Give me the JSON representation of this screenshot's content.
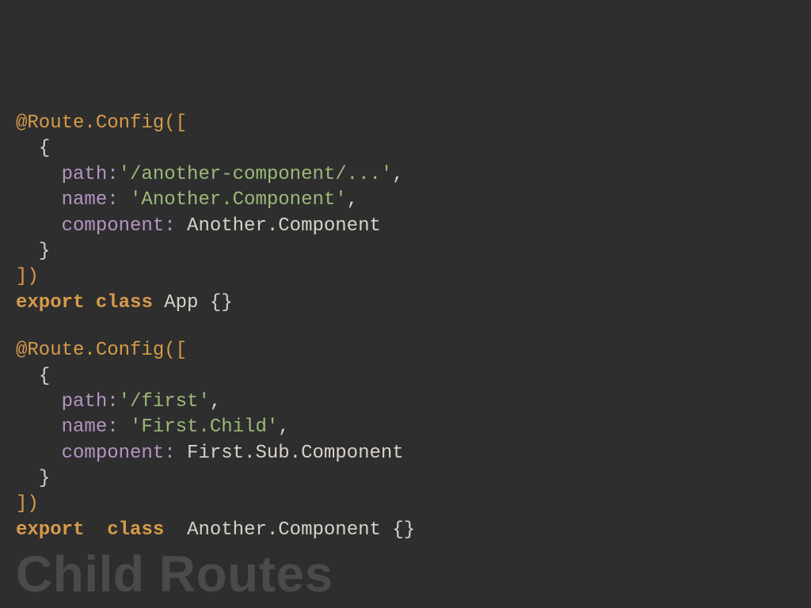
{
  "block1": {
    "decor": "@Route.Config",
    "openParen": "([",
    "openBrace": "{",
    "pathKey": "path:",
    "pathVal": "'/another-component/...'",
    "comma": ",",
    "nameKey": "name:",
    "nameVal": "'Another.Component'",
    "compKey": "component:",
    "compVal": "Another.Component",
    "closeBrace": "}",
    "closeParen": "])",
    "exportKw": "export",
    "classKw": "class",
    "className": "App",
    "classBody": "{}"
  },
  "block2": {
    "decor": "@Route.Config",
    "openParen": "([",
    "openBrace": "{",
    "pathKey": "path:",
    "pathVal": "'/first'",
    "comma": ",",
    "nameKey": "name:",
    "nameVal": "'First.Child'",
    "compKey": "component:",
    "compVal": "First.Sub.Component",
    "closeBrace": "}",
    "closeParen": "])",
    "exportKw": "export",
    "classKw": "class",
    "className": "Another.Component",
    "classBody": "{}"
  },
  "title": "Child Routes"
}
